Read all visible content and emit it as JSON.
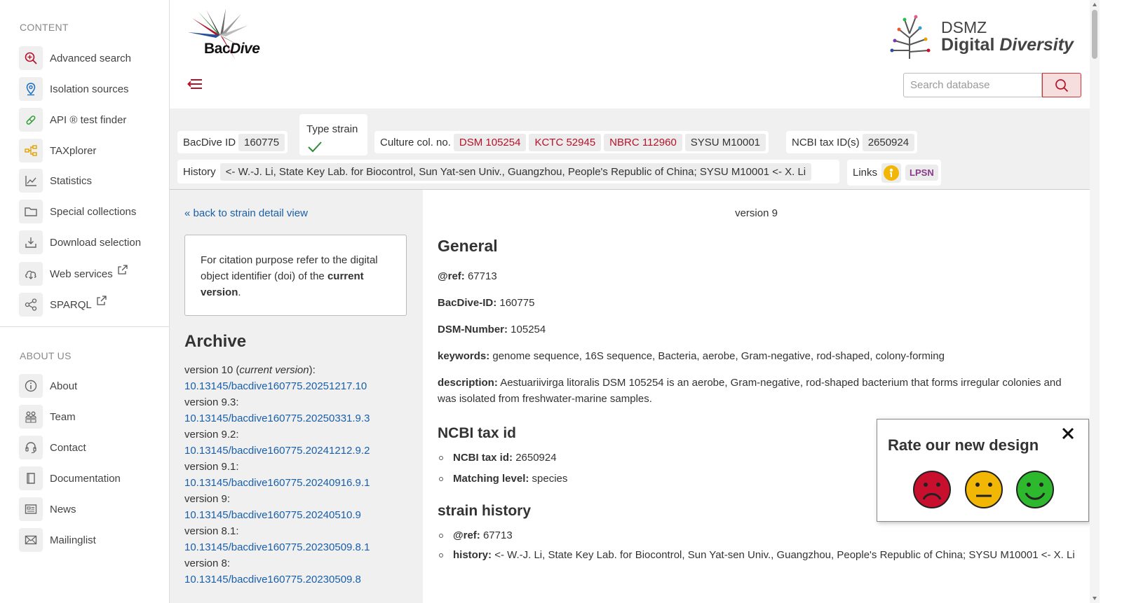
{
  "sidebar": {
    "content_heading": "CONTENT",
    "content_items": [
      {
        "label": "Advanced search",
        "icon": "magnify-plus-icon"
      },
      {
        "label": "Isolation sources",
        "icon": "map-pin-icon"
      },
      {
        "label": "API ® test finder",
        "icon": "test-strip-icon"
      },
      {
        "label": "TAXplorer",
        "icon": "tree-branch-icon"
      },
      {
        "label": "Statistics",
        "icon": "line-chart-icon"
      },
      {
        "label": "Special collections",
        "icon": "folder-icon"
      },
      {
        "label": "Download selection",
        "icon": "download-tray-icon"
      },
      {
        "label": "Web services",
        "icon": "cloud-download-icon"
      },
      {
        "label": "SPARQL",
        "icon": "share-nodes-icon"
      }
    ],
    "about_heading": "ABOUT US",
    "about_items": [
      {
        "label": "About",
        "icon": "info-circle-icon"
      },
      {
        "label": "Team",
        "icon": "people-icon"
      },
      {
        "label": "Contact",
        "icon": "headset-icon"
      },
      {
        "label": "Documentation",
        "icon": "book-icon"
      },
      {
        "label": "News",
        "icon": "newspaper-icon"
      },
      {
        "label": "Mailinglist",
        "icon": "envelope-icon"
      }
    ]
  },
  "header": {
    "logo_prefix": "Bac",
    "logo_suffix": "Dive",
    "dsmz_line1": "DSMZ",
    "dsmz_line2_a": "Digital ",
    "dsmz_line2_b": "Diversity",
    "search_placeholder": "Search database"
  },
  "infobar": {
    "bacdive_id_label": "BacDive ID",
    "bacdive_id": "160775",
    "type_strain_label": "Type strain",
    "culture_label": "Culture col. no.",
    "culture_numbers": [
      {
        "text": "DSM 105254",
        "linked": true
      },
      {
        "text": "KCTC 52945",
        "linked": true
      },
      {
        "text": "NBRC 112960",
        "linked": true
      },
      {
        "text": "SYSU M10001",
        "linked": false
      }
    ],
    "ncbi_label": "NCBI tax ID(s)",
    "ncbi_id": "2650924",
    "history_label": "History",
    "history_text": "<- W.-J. Li, State Key Lab. for Biocontrol, Sun Yat-sen Univ., Guangzhou, People's Republic of China; SYSU M10001 <- X. Li",
    "links_label": "Links",
    "lpsn_label": "LPSN"
  },
  "left": {
    "back_link": "« back to strain detail view",
    "cite_text_a": "For citation purpose refer to the digital object identifier (doi) of the ",
    "cite_text_b": "current version",
    "cite_text_c": ".",
    "archive_title": "Archive",
    "archive": [
      {
        "label": "version 10 (",
        "label_em": "current version",
        "label_end": "):",
        "doi": "10.13145/bacdive160775.20251217.10"
      },
      {
        "label": "version 9.3:",
        "label_em": "",
        "label_end": "",
        "doi": "10.13145/bacdive160775.20250331.9.3"
      },
      {
        "label": "version 9.2:",
        "label_em": "",
        "label_end": "",
        "doi": "10.13145/bacdive160775.20241212.9.2"
      },
      {
        "label": "version 9.1:",
        "label_em": "",
        "label_end": "",
        "doi": "10.13145/bacdive160775.20240916.9.1"
      },
      {
        "label": "version 9:",
        "label_em": "",
        "label_end": "",
        "doi": "10.13145/bacdive160775.20240510.9"
      },
      {
        "label": "version 8.1:",
        "label_em": "",
        "label_end": "",
        "doi": "10.13145/bacdive160775.20230509.8.1"
      },
      {
        "label": "version 8:",
        "label_em": "",
        "label_end": "",
        "doi": "10.13145/bacdive160775.20230509.8"
      }
    ]
  },
  "main": {
    "version": "version 9",
    "general_title": "General",
    "ref_label": "@ref:",
    "ref_value": "67713",
    "bacdive_label": "BacDive-ID:",
    "bacdive_value": "160775",
    "dsm_label": "DSM-Number:",
    "dsm_value": "105254",
    "keywords_label": "keywords:",
    "keywords_value": "genome sequence, 16S sequence, Bacteria, aerobe, Gram-negative, rod-shaped, colony-forming",
    "description_label": "description:",
    "description_value": "Aestuariivirga litoralis DSM 105254 is an aerobe, Gram-negative, rod-shaped bacterium that forms irregular colonies and was isolated from freshwater-marine samples.",
    "ncbi_title": "NCBI tax id",
    "ncbi_items": [
      {
        "label": "NCBI tax id:",
        "value": "2650924"
      },
      {
        "label": "Matching level:",
        "value": "species"
      }
    ],
    "history_title": "strain history",
    "history_items": [
      {
        "label": "@ref:",
        "value": "67713"
      },
      {
        "label": "history:",
        "value": "<- W.-J. Li, State Key Lab. for Biocontrol, Sun Yat-sen Univ., Guangzhou, People's Republic of China; SYSU M10001 <- X. Li"
      }
    ]
  },
  "rating": {
    "title": "Rate our new design",
    "faces": [
      {
        "name": "sad-face-icon",
        "color": "#c8102e"
      },
      {
        "name": "neutral-face-icon",
        "color": "#f2b705"
      },
      {
        "name": "happy-face-icon",
        "color": "#2eb82e"
      }
    ]
  },
  "colors": {
    "accent_red": "#b5122a",
    "link_blue": "#1a5fa8"
  }
}
